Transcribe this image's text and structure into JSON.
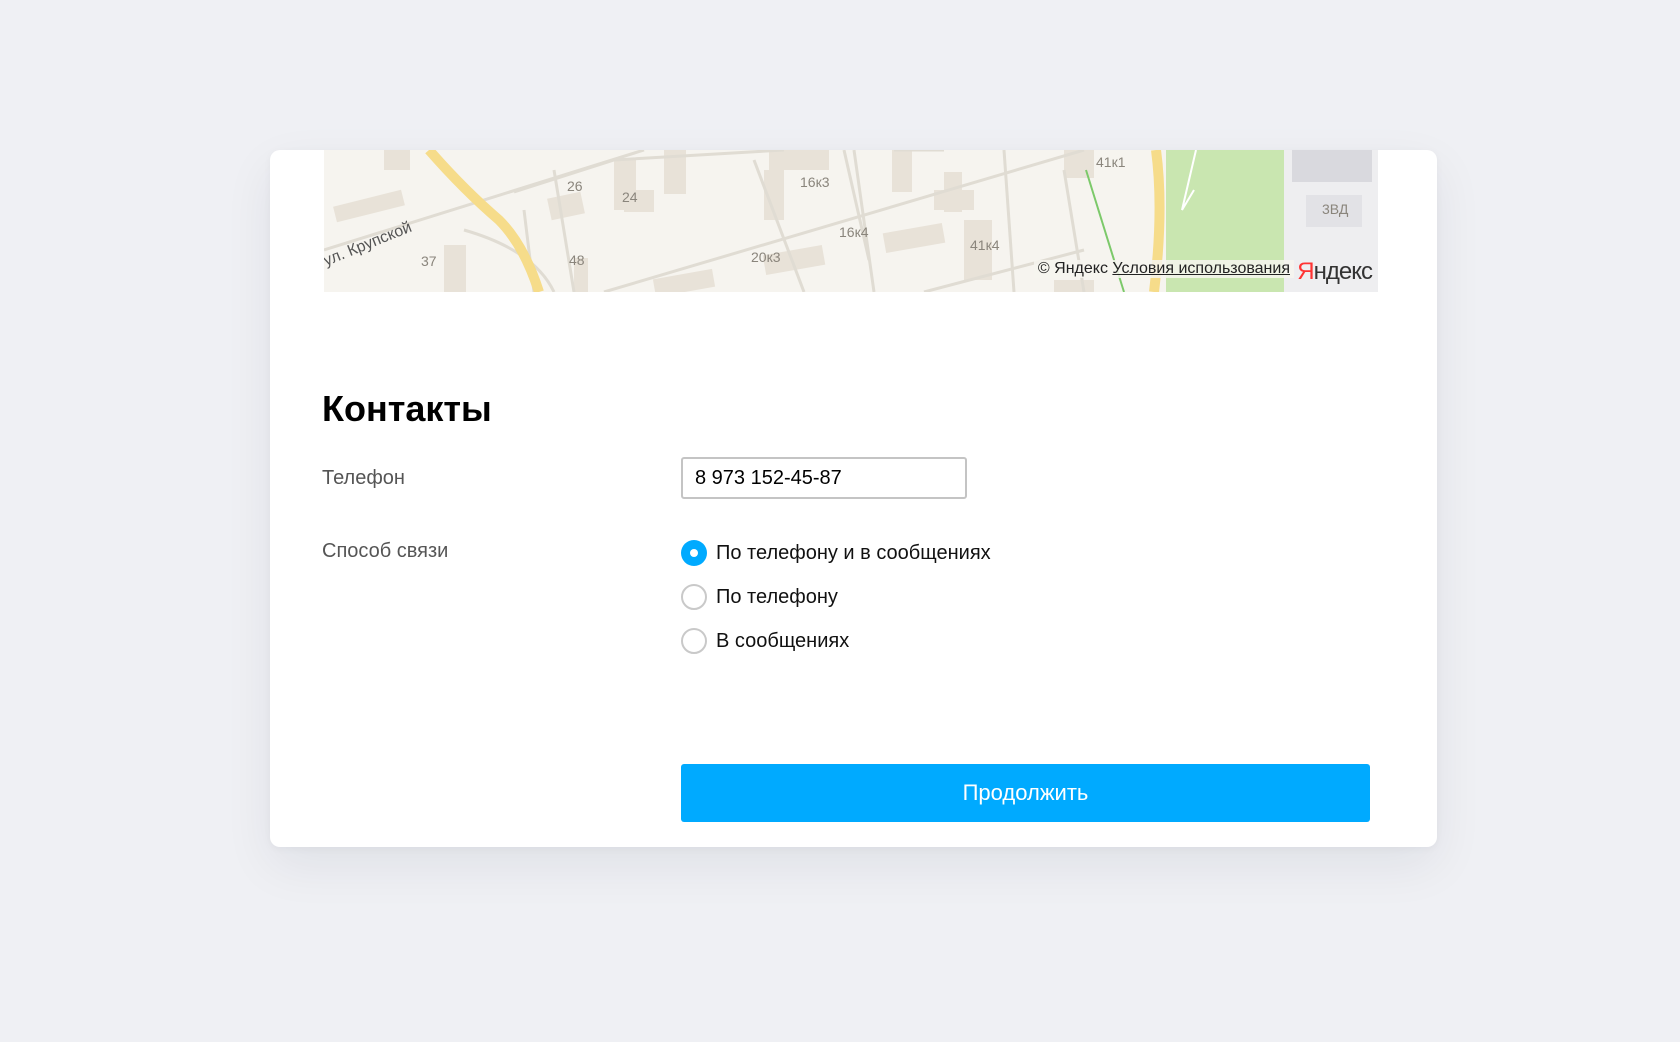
{
  "map": {
    "street_label": "ул. Крупской",
    "house_numbers": [
      "26",
      "24",
      "16к3",
      "16к4",
      "20к3",
      "37",
      "48",
      "41к1",
      "41к4",
      "3ВД"
    ],
    "attribution_copyright": "© Яндекс",
    "attribution_terms": "Условия использования",
    "logo_first": "Я",
    "logo_rest": "ндекс"
  },
  "contacts": {
    "title": "Контакты",
    "phone_label": "Телефон",
    "phone_value": "8 973 152-45-87",
    "method_label": "Способ связи",
    "options": [
      {
        "label": "По телефону и в сообщениях",
        "checked": true
      },
      {
        "label": "По телефону",
        "checked": false
      },
      {
        "label": "В сообщениях",
        "checked": false
      }
    ]
  },
  "actions": {
    "continue_label": "Продолжить"
  },
  "colors": {
    "accent": "#00aaff",
    "background": "#eff0f4",
    "card": "#ffffff"
  }
}
